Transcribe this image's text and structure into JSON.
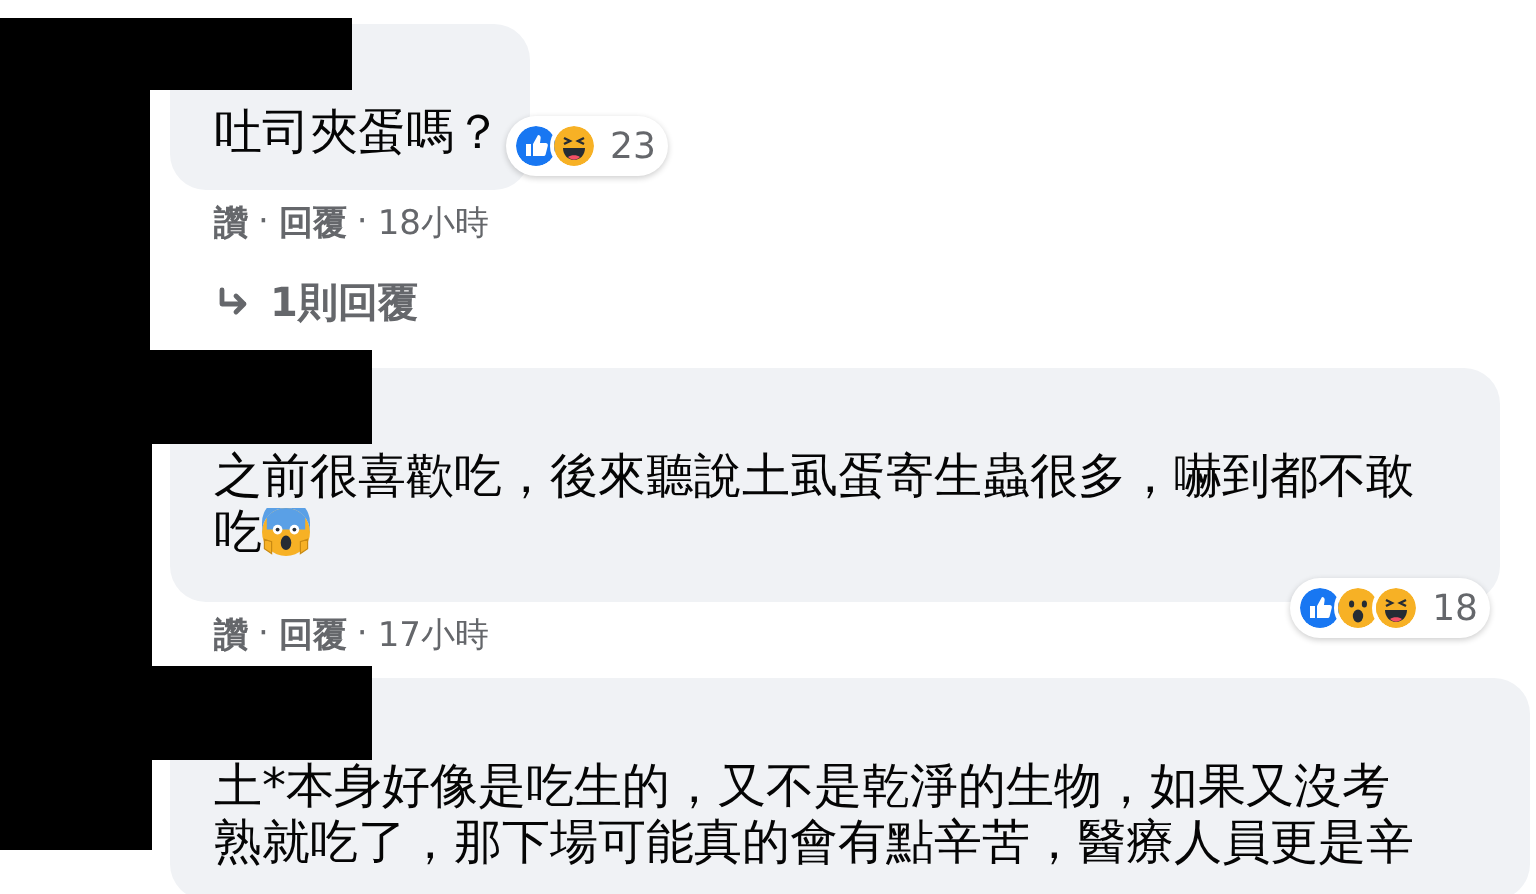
{
  "comments": [
    {
      "text": "吐司夾蛋嗎？",
      "scream_emoji": false,
      "reactions": {
        "like": true,
        "wow": false,
        "haha": true,
        "count": "23"
      },
      "actions": [
        "讚",
        "回覆"
      ],
      "separators": [
        "·",
        "·"
      ],
      "time": "18小時",
      "replies_link": "1則回覆"
    },
    {
      "text": "之前很喜歡吃，後來聽說土虱蛋寄生蟲很多，嚇到都不敢吃",
      "scream_emoji": true,
      "reactions": {
        "like": true,
        "wow": true,
        "haha": true,
        "count": "18"
      },
      "actions": [
        "讚",
        "回覆"
      ],
      "separators": [
        "·",
        "·"
      ],
      "time": "17小時"
    },
    {
      "text": "土*本身好像是吃生的，又不是乾淨的生物，如果又沒考熟就吃了，那下場可能真的會有點辛苦，醫療人員更是辛",
      "scream_emoji": false
    }
  ]
}
